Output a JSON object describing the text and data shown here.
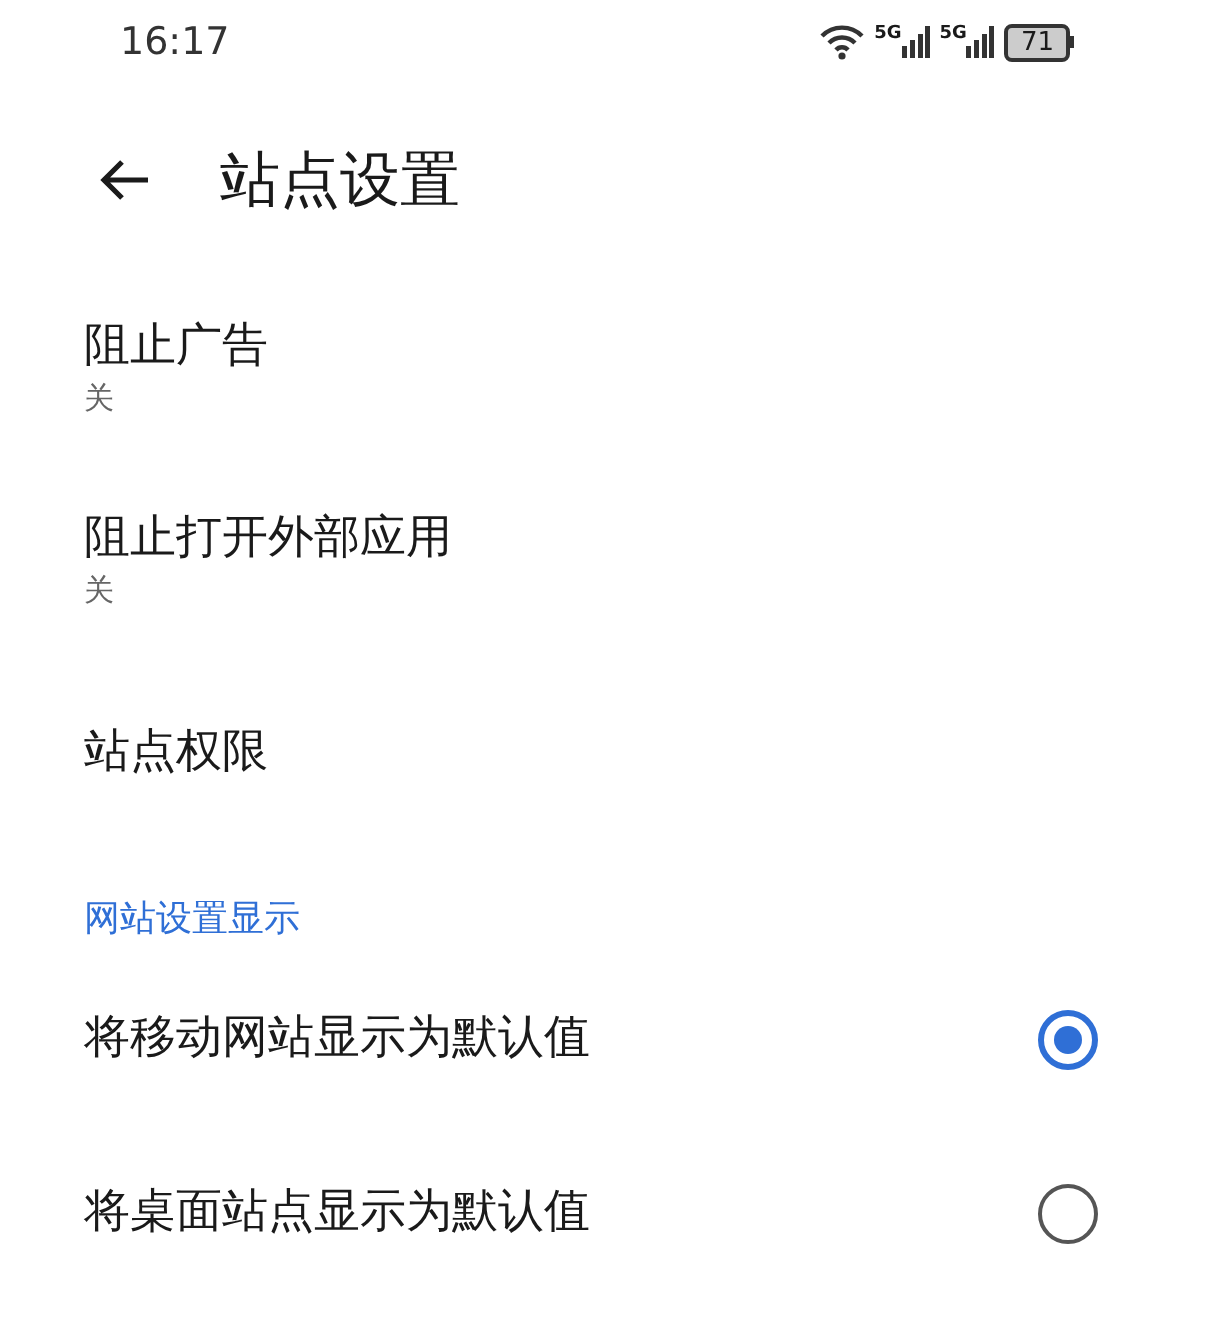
{
  "status_bar": {
    "time": "16:17",
    "network_1": "5G",
    "network_2": "5G",
    "battery": "71"
  },
  "header": {
    "title": "站点设置"
  },
  "items": [
    {
      "title": "阻止广告",
      "subtitle": "关"
    },
    {
      "title": "阻止打开外部应用",
      "subtitle": "关"
    },
    {
      "title": "站点权限"
    }
  ],
  "section": {
    "title": "网站设置显示"
  },
  "options": [
    {
      "label": "将移动网站显示为默认值",
      "selected": true
    },
    {
      "label": "将桌面站点显示为默认值",
      "selected": false
    }
  ]
}
